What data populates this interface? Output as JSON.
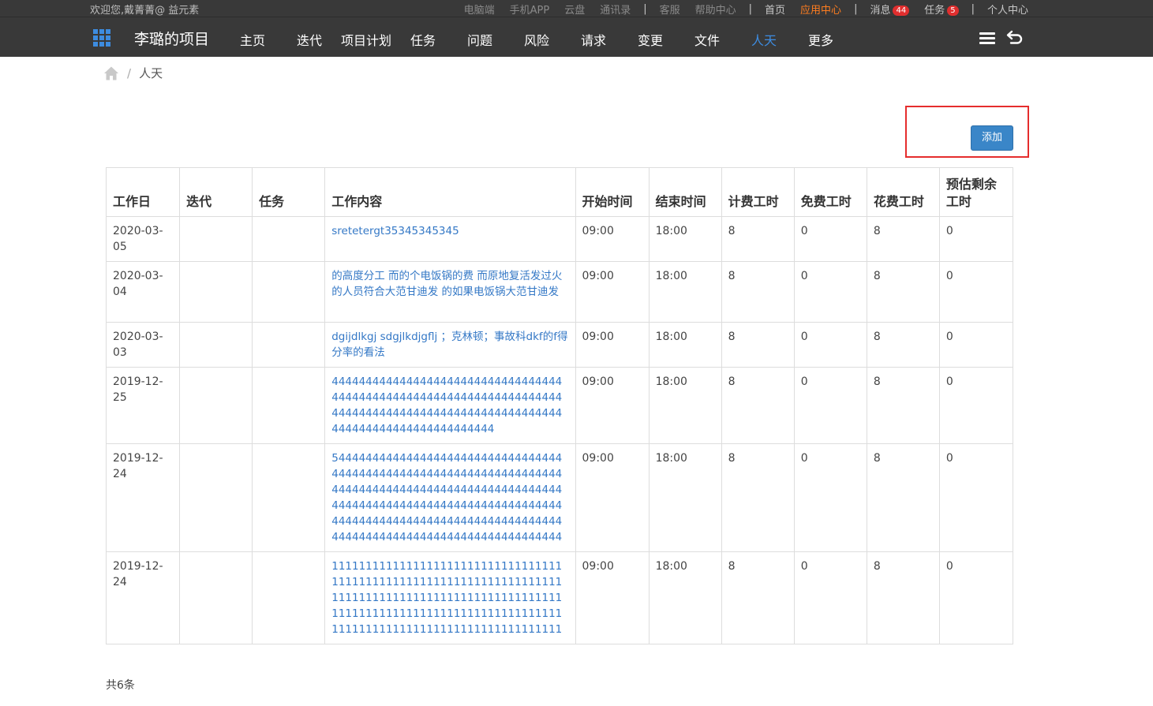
{
  "topbar": {
    "welcome": "欢迎您,戴菁菁@ 益元素",
    "links": [
      "电脑端",
      "手机APP",
      "云盘",
      "通讯录"
    ],
    "service": "客服",
    "help": "帮助中心",
    "home": "首页",
    "app_center": "应用中心",
    "messages_label": "消息",
    "messages_count": "44",
    "tasks_label": "任务",
    "tasks_count": "5",
    "personal": "个人中心"
  },
  "navbar": {
    "project_title": "李璐的项目",
    "items": [
      "主页",
      "迭代",
      "项目计划",
      "任务",
      "问题",
      "风险",
      "请求",
      "变更",
      "文件",
      "人天",
      "更多"
    ],
    "active": "人天"
  },
  "breadcrumb": {
    "current": "人天"
  },
  "toolbar": {
    "add_label": "添加"
  },
  "table": {
    "headers": [
      "工作日",
      "迭代",
      "任务",
      "工作内容",
      "开始时间",
      "结束时间",
      "计费工时",
      "免费工时",
      "花费工时",
      "预估剩余工时"
    ],
    "rows": [
      {
        "date": "2020-03-05",
        "iteration": "",
        "task": "",
        "content": "sretetergt35345345345",
        "start": "09:00",
        "end": "18:00",
        "billable": "8",
        "free": "0",
        "spent": "8",
        "remaining": "0"
      },
      {
        "date": "2020-03-04",
        "iteration": "",
        "task": "",
        "content": "的高度分工 而的个电饭锅的费 而原地复活发过火 的人员符合大范甘迪发 的如果电饭锅大范甘迪发",
        "start": "09:00",
        "end": "18:00",
        "billable": "8",
        "free": "0",
        "spent": "8",
        "remaining": "0"
      },
      {
        "date": "2020-03-03",
        "iteration": "",
        "task": "",
        "content": "dgijdlkgj sdgjlkdjgflj ；克林顿；事故科dkf的f得分率的看法",
        "start": "09:00",
        "end": "18:00",
        "billable": "8",
        "free": "0",
        "spent": "8",
        "remaining": "0"
      },
      {
        "date": "2019-12-25",
        "iteration": "",
        "task": "",
        "content": "444444444444444444444444444444444444444444444444444444444444444444444444444444444444444444444444444444444444444444444444444444",
        "start": "09:00",
        "end": "18:00",
        "billable": "8",
        "free": "0",
        "spent": "8",
        "remaining": "0"
      },
      {
        "date": "2019-12-24",
        "iteration": "",
        "task": "",
        "content": "544444444444444444444444444444444444444444444444444444444444444444444444444444444444444444444444444444444444444444444444444444444444444444444444444444444444444444444444444444444444444444444444444444444444",
        "start": "09:00",
        "end": "18:00",
        "billable": "8",
        "free": "0",
        "spent": "8",
        "remaining": "0"
      },
      {
        "date": "2019-12-24",
        "iteration": "",
        "task": "",
        "content": "11111111111111111111111111111111111111111111111111111111111111111111111111111111111111111111111111111111111111111111111111111111111111111111111111111111111111111111111111",
        "start": "09:00",
        "end": "18:00",
        "billable": "8",
        "free": "0",
        "spent": "8",
        "remaining": "0"
      }
    ]
  },
  "footer": {
    "total": "共6条"
  }
}
